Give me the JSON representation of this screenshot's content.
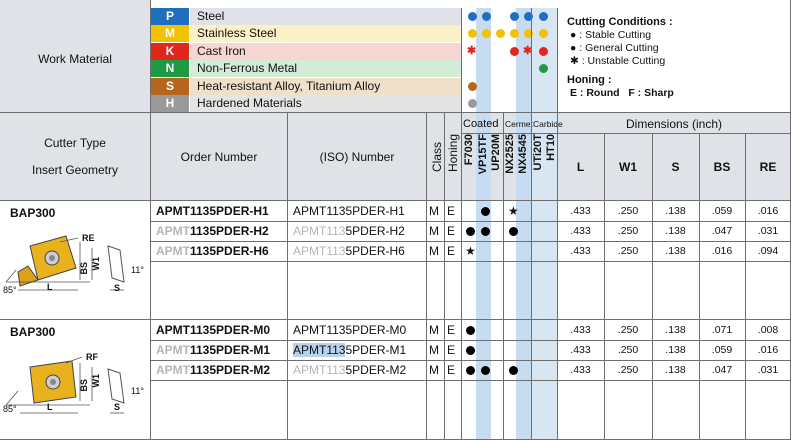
{
  "header": {
    "work_material_label": "Work Material",
    "materials": [
      {
        "code": "P",
        "name": "Steel",
        "code_color": "#1f6fbf",
        "row_color": "#dfe2e6"
      },
      {
        "code": "M",
        "name": "Stainless Steel",
        "code_color": "#f2c200",
        "row_color": "#fbf1c7"
      },
      {
        "code": "K",
        "name": "Cast Iron",
        "code_color": "#e0261d",
        "row_color": "#f7d6d2"
      },
      {
        "code": "N",
        "name": "Non-Ferrous Metal",
        "code_color": "#1e9a45",
        "row_color": "#d3ecd8"
      },
      {
        "code": "S",
        "name": "Heat-resistant Alloy, Titanium Alloy",
        "code_color": "#b5651d",
        "row_color": "#f0dfc9"
      },
      {
        "code": "H",
        "name": "Hardened Materials",
        "code_color": "#9a9a9a",
        "row_color": "#e4e4e4"
      }
    ],
    "cutting_conditions_title": "Cutting Conditions :",
    "cutting_conditions": [
      "● : Stable Cutting",
      "● : General Cutting",
      "✱ : Unstable Cutting"
    ],
    "honing_title": "Honing :",
    "honing_text": "E : Round   F : Sharp"
  },
  "columns": {
    "cutter_type": "Cutter Type",
    "insert_geometry": "Insert Geometry",
    "order_number": "Order Number",
    "iso_number": "(ISO) Number",
    "class": "Class",
    "honing": "Honing",
    "coated": "Coated",
    "cermet": "Cermet",
    "carbide": "Carbide",
    "grades": [
      "F7030",
      "VP15TF",
      "UP20M",
      "NX2525",
      "NX4545",
      "UTi20T",
      "HT10"
    ],
    "dimensions": "Dimensions (inch)",
    "dim_cols": [
      "L",
      "W1",
      "S",
      "BS",
      "RE"
    ]
  },
  "groups": [
    {
      "cutter": "BAP300",
      "radius_label": "RE",
      "angle1": "85°",
      "angle2": "11°",
      "rows": [
        {
          "order_prefix": "APMT",
          "order_suffix": "1135PDER-H1",
          "iso": "APMT1135PDER-H1",
          "class": "M",
          "honing": "E",
          "marks": [
            "",
            "●",
            "",
            "★",
            "",
            ""
          ],
          "L": ".433",
          "W1": ".250",
          "S": ".138",
          "BS": ".059",
          "RE": ".016"
        },
        {
          "order_prefix": "APMT",
          "order_suffix": "1135PDER-H2",
          "iso": "APMT1135PDER-H2",
          "class": "M",
          "honing": "E",
          "marks": [
            "●",
            "●",
            "",
            "●",
            "",
            ""
          ],
          "L": ".433",
          "W1": ".250",
          "S": ".138",
          "BS": ".047",
          "RE": ".031"
        },
        {
          "order_prefix": "APMT",
          "order_suffix": "1135PDER-H6",
          "iso": "APMT1135PDER-H6",
          "class": "M",
          "honing": "E",
          "marks": [
            "★",
            "",
            "",
            "",
            "",
            ""
          ],
          "L": ".433",
          "W1": ".250",
          "S": ".138",
          "BS": ".016",
          "RE": ".094"
        }
      ]
    },
    {
      "cutter": "BAP300",
      "radius_label": "RE",
      "angle1": "85°",
      "angle2": "11°",
      "rows": [
        {
          "order_prefix": "APMT",
          "order_suffix": "1135PDER-M0",
          "iso": "APMT1135PDER-M0",
          "class": "M",
          "honing": "E",
          "marks": [
            "●",
            "",
            "",
            "",
            "",
            ""
          ],
          "L": ".433",
          "W1": ".250",
          "S": ".138",
          "BS": ".071",
          "RE": ".008"
        },
        {
          "order_prefix": "APMT",
          "order_suffix": "1135PDER-M1",
          "iso": "APMT1135PDER-M1",
          "class": "M",
          "honing": "E",
          "marks": [
            "●",
            "",
            "",
            "",
            "",
            ""
          ],
          "L": ".433",
          "W1": ".250",
          "S": ".138",
          "BS": ".059",
          "RE": ".016"
        },
        {
          "order_prefix": "APMT",
          "order_suffix": "1135PDER-M2",
          "iso": "APMT1135PDER-M2",
          "class": "M",
          "honing": "E",
          "marks": [
            "●",
            "●",
            "",
            "●",
            "",
            ""
          ],
          "L": ".433",
          "W1": ".250",
          "S": ".138",
          "BS": ".047",
          "RE": ".031"
        }
      ]
    }
  ],
  "diagram_labels": {
    "re": "RE",
    "bs": "BS",
    "w1": "W1",
    "l": "L",
    "s": "S"
  }
}
